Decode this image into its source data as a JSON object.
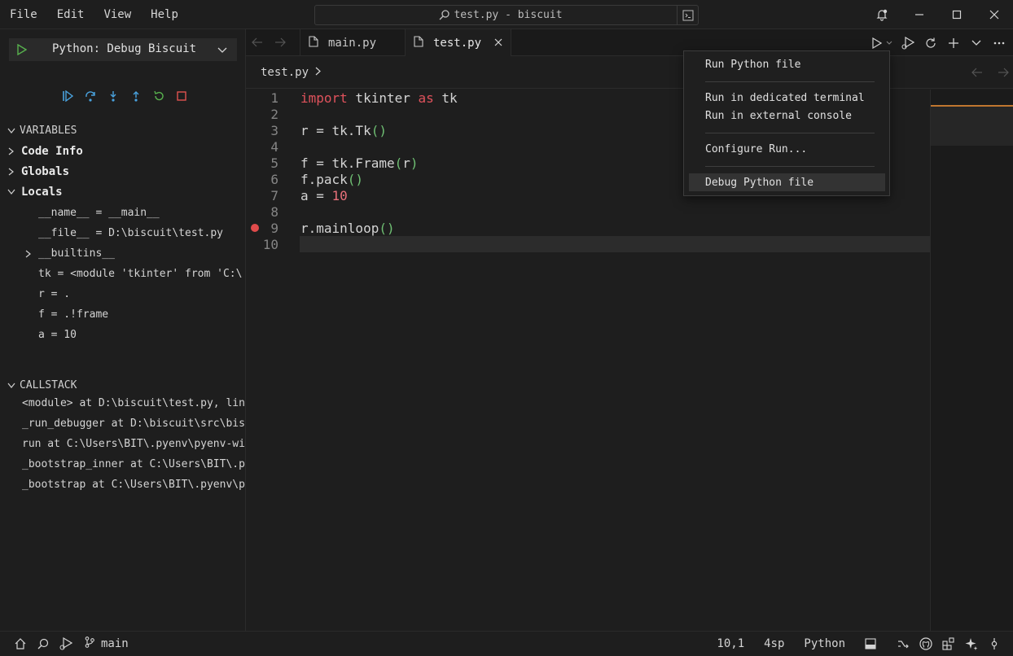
{
  "menu": {
    "file": "File",
    "edit": "Edit",
    "view": "View",
    "help": "Help"
  },
  "search": {
    "text": "test.py - biscuit"
  },
  "debug": {
    "config_label": "Python: Debug Biscuit"
  },
  "variables": {
    "header": "VARIABLES",
    "code_info": "Code Info",
    "globals": "Globals",
    "locals": "Locals",
    "items": [
      "__name__ = __main__",
      "__file__ = D:\\biscuit\\test.py",
      "__builtins__",
      "tk = <module 'tkinter' from 'C:\\",
      "r = .",
      "f = .!frame",
      "a = 10"
    ]
  },
  "callstack": {
    "header": "CALLSTACK",
    "frames": [
      "<module> at D:\\biscuit\\test.py, lin",
      "_run_debugger at D:\\biscuit\\src\\bis",
      "run at C:\\Users\\BIT\\.pyenv\\pyenv-wi",
      "_bootstrap_inner at C:\\Users\\BIT\\.p",
      "_bootstrap at C:\\Users\\BIT\\.pyenv\\p"
    ]
  },
  "tabs": {
    "main": "main.py",
    "test": "test.py"
  },
  "breadcrumb": {
    "file": "test.py"
  },
  "editor": {
    "line_numbers": [
      "1",
      "2",
      "3",
      "4",
      "5",
      "6",
      "7",
      "8",
      "9",
      "10"
    ],
    "lines": {
      "l1_import": "import",
      "l1_mod": " tkinter ",
      "l1_as": "as",
      "l1_alias": " tk",
      "l3_pre": "r = tk.Tk",
      "l3_paren": "()",
      "l5_pre": "f = tk.Frame",
      "l5_open": "(",
      "l5_arg": "r",
      "l5_close": ")",
      "l6_pre": "f.pack",
      "l6_paren": "()",
      "l7_pre": "a = ",
      "l7_num": "10",
      "l9_pre": "r.mainloop",
      "l9_paren": "()"
    },
    "breakpoint_line": 9,
    "current_line": 10
  },
  "run_menu": {
    "run_python_file": "Run Python file",
    "run_dedicated_terminal": "Run in dedicated terminal",
    "run_external_console": "Run in external console",
    "configure_run": "Configure Run...",
    "debug_python_file": "Debug Python file"
  },
  "status": {
    "branch": "main",
    "cursor": "10,1",
    "indent": "4sp",
    "language": "Python"
  },
  "colors": {
    "keyword": "#e0525c",
    "number": "#e8707a",
    "paren": "#6fbf73",
    "debug_blue": "#4aa3df",
    "debug_green": "#57b04d",
    "stop_red": "#e0524f",
    "breakpoint": "#e04b4b",
    "minimap_accent": "#c0762f"
  }
}
